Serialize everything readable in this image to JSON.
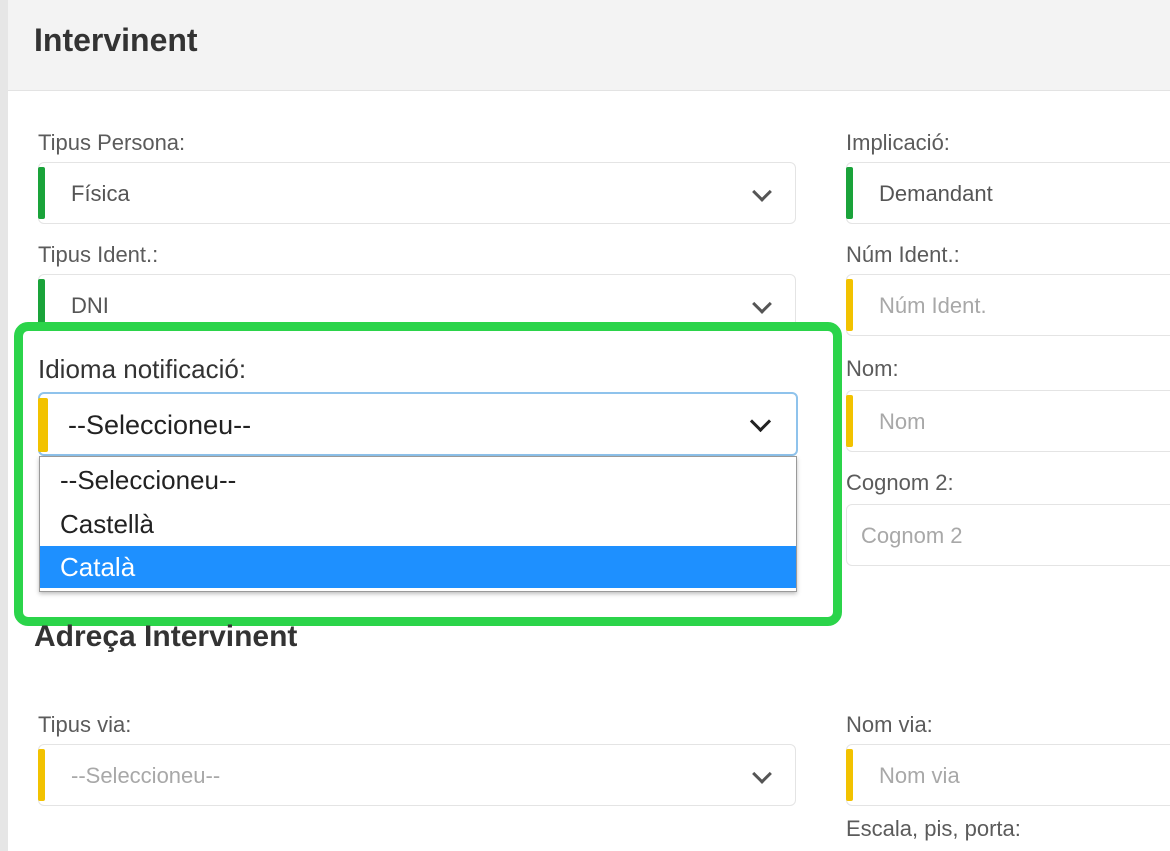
{
  "header": {
    "title": "Intervinent"
  },
  "fields": {
    "tipus_persona": {
      "label": "Tipus Persona:",
      "value": "Física"
    },
    "implicacio": {
      "label": "Implicació:",
      "value": "Demandant"
    },
    "tipus_ident": {
      "label": "Tipus Ident.:",
      "value": "DNI"
    },
    "num_ident": {
      "label": "Núm Ident.:",
      "placeholder": "Núm Ident."
    },
    "nom": {
      "label": "Nom:",
      "placeholder": "Nom"
    },
    "cognom2": {
      "label": "Cognom 2:",
      "placeholder": "Cognom 2"
    },
    "tipus_via": {
      "label": "Tipus via:",
      "value": "--Seleccioneu--"
    },
    "nom_via": {
      "label": "Nom via:",
      "placeholder": "Nom via"
    },
    "escala": {
      "label": "Escala, pis, porta:"
    }
  },
  "idioma": {
    "label": "Idioma notificació:",
    "selected": "--Seleccioneu--",
    "options": [
      "--Seleccioneu--",
      "Castellà",
      "Català"
    ]
  },
  "address_section": {
    "title": "Adreça Intervinent"
  },
  "colors": {
    "required_bar": "#1aa33a",
    "optional_bar": "#f2c200",
    "highlight": "#2bd44a",
    "option_selected": "#1e90ff"
  }
}
